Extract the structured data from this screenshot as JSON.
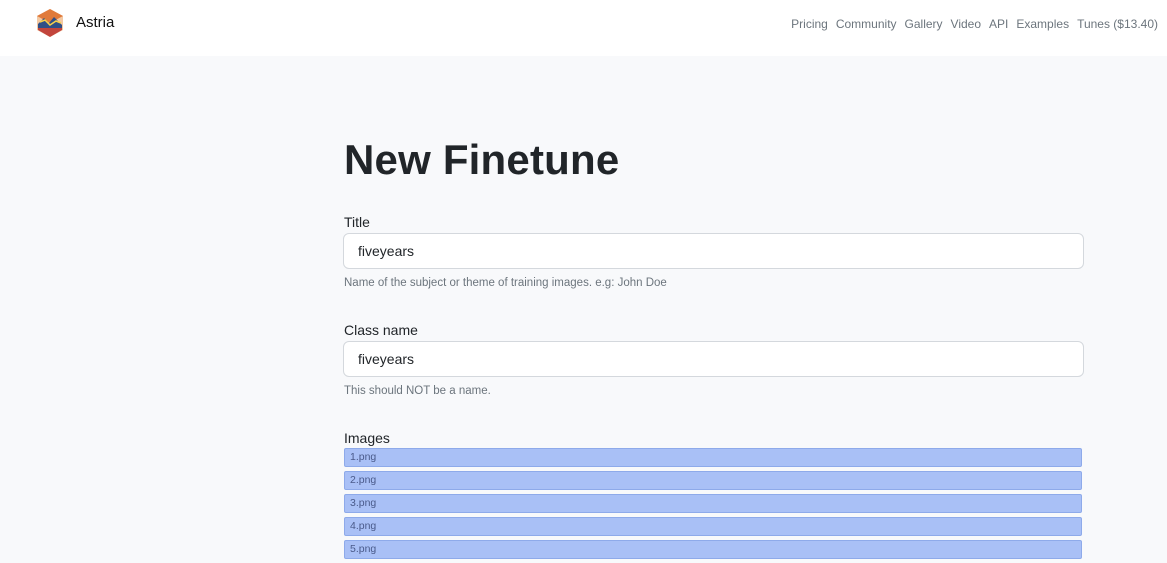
{
  "navbar": {
    "brand_name": "Astria",
    "logo_icon": "astria-hexagon-logo",
    "links": [
      {
        "label": "Pricing"
      },
      {
        "label": "Community"
      },
      {
        "label": "Gallery"
      },
      {
        "label": "Video"
      },
      {
        "label": "API"
      },
      {
        "label": "Examples"
      },
      {
        "label": "Tunes ($13.40)"
      }
    ]
  },
  "form": {
    "heading": "New Finetune",
    "title": {
      "label": "Title",
      "value": "fiveyears",
      "help": "Name of the subject or theme of training images. e.g: John Doe"
    },
    "class_name": {
      "label": "Class name",
      "value": "fiveyears",
      "help": "This should NOT be a name."
    },
    "images": {
      "label": "Images",
      "files": [
        "1.png",
        "2.png",
        "3.png",
        "4.png",
        "5.png"
      ]
    }
  },
  "colors": {
    "page_background": "#f8f9fb",
    "navbar_background": "#ffffff",
    "file_item_background": "#a9c0f6",
    "muted_text": "#6c757d"
  }
}
